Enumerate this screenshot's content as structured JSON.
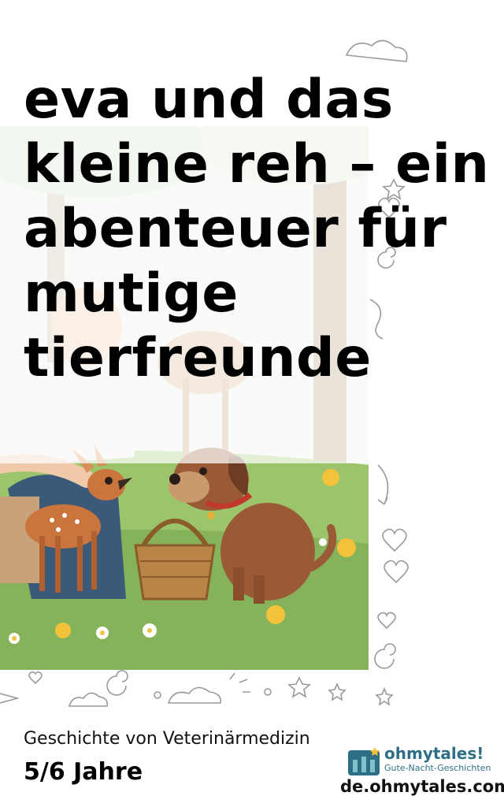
{
  "cover": {
    "title": "eva und das kleine reh – ein abenteuer für mutige tierfreunde",
    "category": "Geschichte von Veterinärmedizin",
    "age_group": "5/6 Jahre"
  },
  "brand": {
    "logo_word": "ohmytales!",
    "logo_tagline": "Gute-Nacht-Geschichten",
    "website": "de.ohmytales.com"
  },
  "illustration": {
    "subject": "Eva kneels and pets a small fawn beside a brown dog and a wicker basket in a flowery forest meadow",
    "icon": "fawn-and-dog-illustration"
  },
  "colors": {
    "meadow": "#9cc46a",
    "sky": "#e8efe6",
    "dog": "#9a5a36",
    "fawn": "#c9753d",
    "brand": "#2f6f86"
  }
}
